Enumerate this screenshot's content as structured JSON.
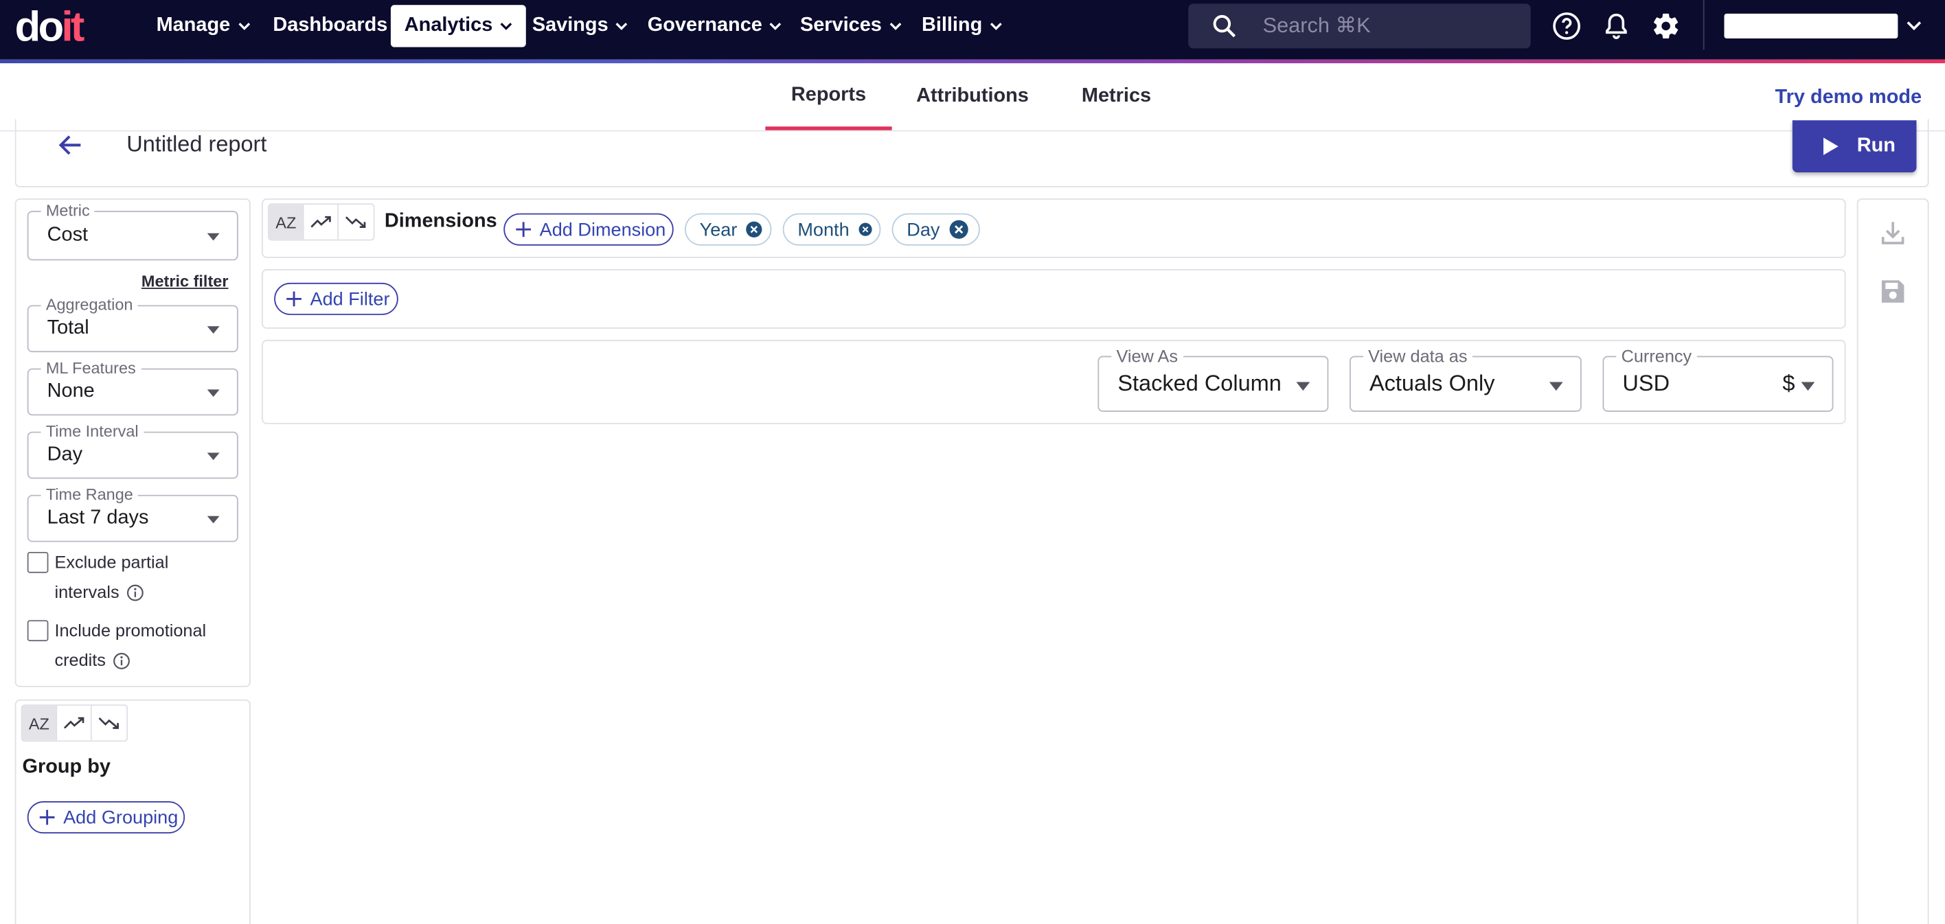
{
  "nav": {
    "items": [
      {
        "label": "Manage",
        "has_menu": true
      },
      {
        "label": "Dashboards",
        "has_menu": false
      },
      {
        "label": "Analytics",
        "has_menu": true,
        "active": true
      },
      {
        "label": "Savings",
        "has_menu": true
      },
      {
        "label": "Governance",
        "has_menu": true
      },
      {
        "label": "Services",
        "has_menu": true
      },
      {
        "label": "Billing",
        "has_menu": true
      }
    ],
    "search_placeholder": "Search ⌘K",
    "icons": [
      "help-icon",
      "bell-icon",
      "gear-icon"
    ]
  },
  "logo": {
    "part1": "do",
    "part2": "it"
  },
  "tabs": [
    {
      "label": "Reports",
      "active": true
    },
    {
      "label": "Attributions",
      "active": false
    },
    {
      "label": "Metrics",
      "active": false
    }
  ],
  "try_demo": "Try demo mode",
  "report": {
    "title": "Untitled report",
    "run_label": "Run"
  },
  "left": {
    "metric": {
      "label": "Metric",
      "value": "Cost"
    },
    "metric_filter": "Metric filter",
    "aggregation": {
      "label": "Aggregation",
      "value": "Total"
    },
    "ml_features": {
      "label": "ML Features",
      "value": "None"
    },
    "time_interval": {
      "label": "Time Interval",
      "value": "Day"
    },
    "time_range": {
      "label": "Time Range",
      "value": "Last 7 days"
    },
    "exclude_partial": {
      "line1": "Exclude partial",
      "line2": "intervals",
      "checked": false
    },
    "include_promo": {
      "line1": "Include promotional",
      "line2": "credits",
      "checked": false
    }
  },
  "group": {
    "sort_az": "AZ",
    "title": "Group by",
    "add_label": "Add Grouping"
  },
  "dimensions": {
    "sort_az": "AZ",
    "title": "Dimensions",
    "add_label": "Add Dimension",
    "chips": [
      "Year",
      "Month",
      "Day"
    ]
  },
  "filter": {
    "add_label": "Add Filter"
  },
  "view": {
    "view_as": {
      "label": "View As",
      "value": "Stacked Column"
    },
    "view_data_as": {
      "label": "View data as",
      "value": "Actuals Only"
    },
    "currency": {
      "label": "Currency",
      "value": "USD",
      "symbol": "$"
    }
  },
  "colors": {
    "navbar": "#0b0b2e",
    "accent_pink": "#e0315a",
    "primary": "#3b3ea8"
  }
}
